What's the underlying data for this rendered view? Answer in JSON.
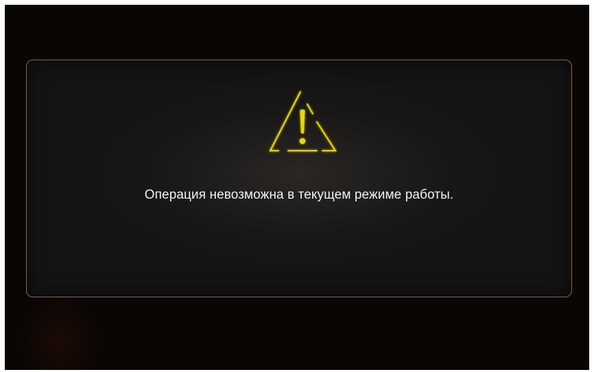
{
  "dialog": {
    "icon": "warning-icon",
    "message": "Операция невозможна в текущем режиме работы."
  },
  "colors": {
    "background": "#0a0604",
    "dialog_border": "#8a6a4e",
    "icon": "#e8d60e",
    "text": "#f2f2f2"
  }
}
